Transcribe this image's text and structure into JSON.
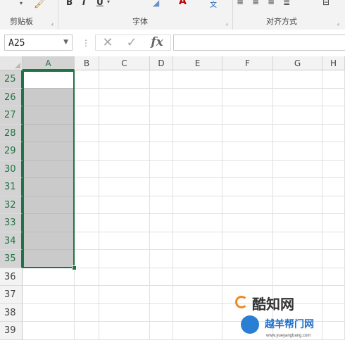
{
  "ribbon": {
    "groups": [
      {
        "label": "剪贴板"
      },
      {
        "label": "字体"
      },
      {
        "label": "对齐方式"
      }
    ],
    "top_glyphs": [
      "B",
      "I",
      "U"
    ]
  },
  "formula_bar": {
    "name_box": "A25",
    "fx_label": "fx",
    "cancel": "✕",
    "enter": "✓",
    "formula": ""
  },
  "sheet": {
    "columns": [
      "A",
      "B",
      "C",
      "D",
      "E",
      "F",
      "G",
      "H"
    ],
    "rows": [
      "25",
      "26",
      "27",
      "28",
      "29",
      "30",
      "31",
      "32",
      "33",
      "34",
      "35",
      "36",
      "37",
      "38",
      "39"
    ],
    "selected_column": "A",
    "selected_rows": [
      "25",
      "26",
      "27",
      "28",
      "29",
      "30",
      "31",
      "32",
      "33",
      "34",
      "35"
    ],
    "active_cell": "A25"
  },
  "watermark": {
    "line1": "酷知网",
    "line2": "越羊帮门网",
    "url": "www.yueyangbang.com"
  },
  "colors": {
    "accent": "#217346",
    "selection": "#c8c8c8",
    "ribbon_bg": "#f3f3f3"
  }
}
